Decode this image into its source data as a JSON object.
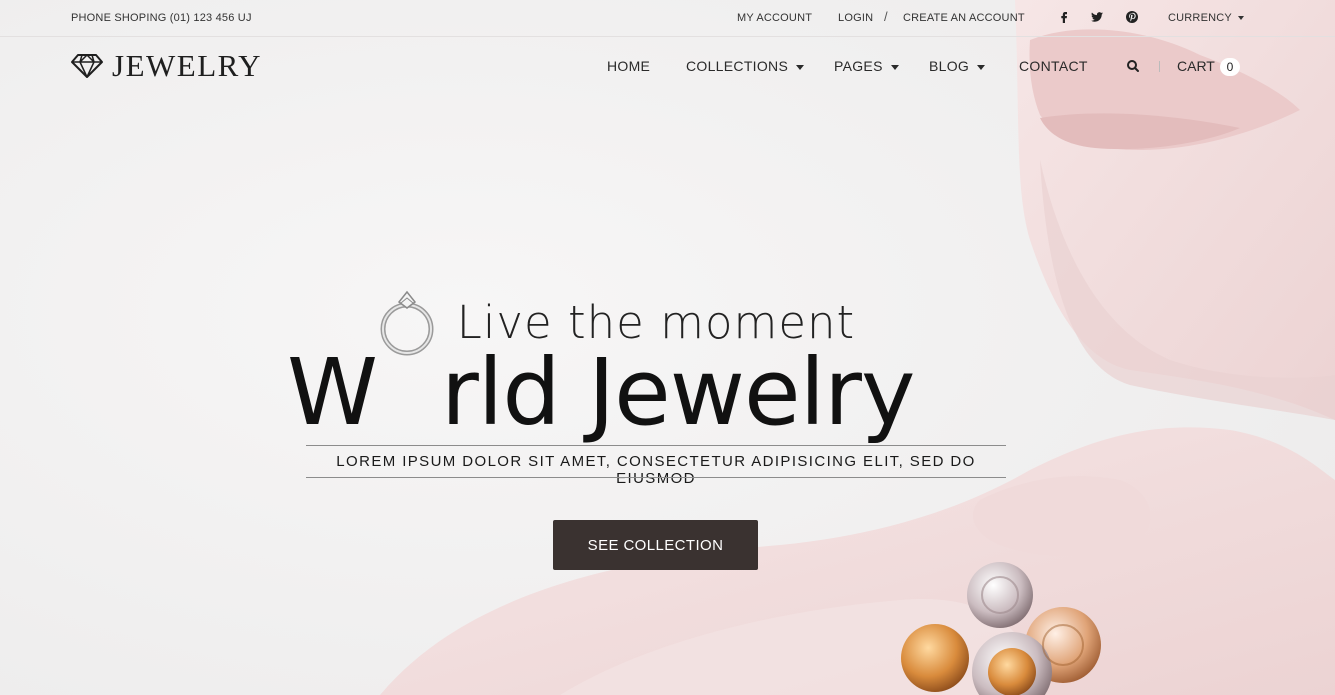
{
  "topbar": {
    "phone": "PHONE SHOPING (01) 123 456 UJ",
    "my_account": "MY ACCOUNT",
    "login": "LOGIN",
    "separator": "/",
    "create_account": "CREATE AN ACCOUNT",
    "social_icons": [
      "facebook-icon",
      "twitter-icon",
      "pinterest-icon"
    ],
    "currency": "CURRENCY"
  },
  "header": {
    "logo_text": "JEWELRY",
    "nav": {
      "home": "HOME",
      "collections": "COLLECTIONS",
      "pages": "PAGES",
      "blog": "BLOG",
      "contact": "CONTACT"
    },
    "cart_label": "CART",
    "cart_count": "0"
  },
  "hero": {
    "tagline": "Live the moment",
    "headline_part1": "W",
    "headline_ring_letter": "o",
    "headline_part2": "rld Jewelry",
    "subtitle": "LOREM IPSUM DOLOR SIT AMET, CONSECTETUR ADIPISICING ELIT, SED DO EIUSMOD",
    "cta_label": "SEE COLLECTION"
  },
  "colors": {
    "background": "#f3f2f2",
    "button": "#3a3230",
    "skin": "#f1dcdc"
  }
}
